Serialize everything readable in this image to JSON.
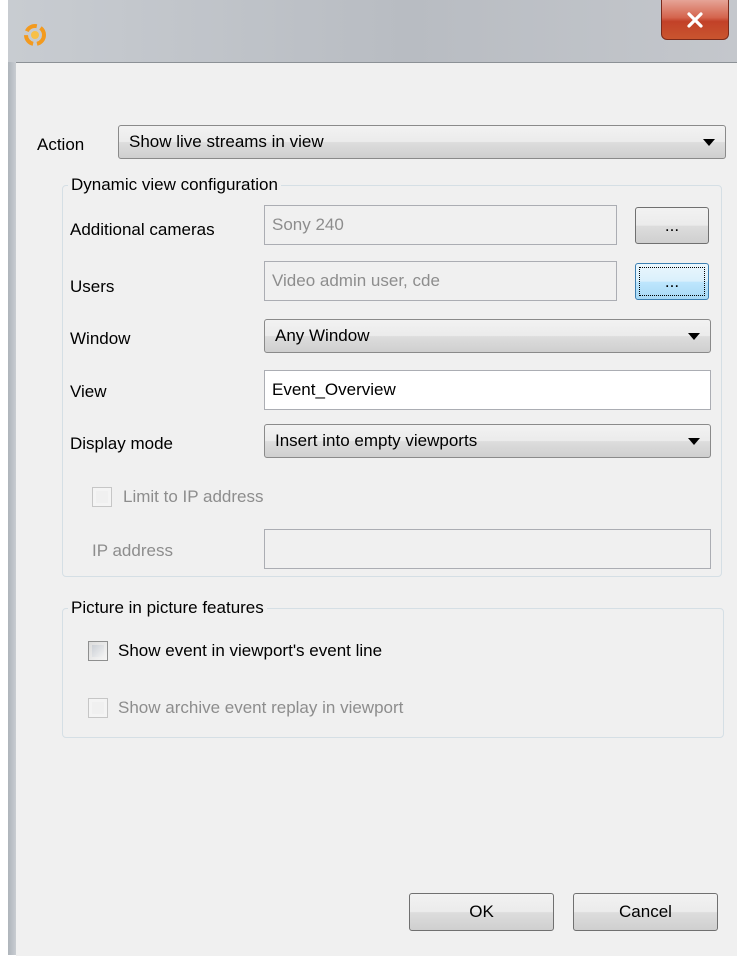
{
  "titlebar": {
    "icon": "app-logo-icon",
    "close_icon": "close-x-icon"
  },
  "action": {
    "label": "Action",
    "selected": "Show live streams in view"
  },
  "dynamic_group": {
    "title": "Dynamic view configuration",
    "additional_cameras": {
      "label": "Additional cameras",
      "value": "Sony 240",
      "browse": "..."
    },
    "users": {
      "label": "Users",
      "value": "Video admin user, cde",
      "browse": "..."
    },
    "window": {
      "label": "Window",
      "selected": "Any Window"
    },
    "view": {
      "label": "View",
      "value": "Event_Overview"
    },
    "display_mode": {
      "label": "Display mode",
      "selected": "Insert into empty viewports"
    },
    "limit_ip": {
      "label": "Limit to IP address",
      "checked": false,
      "enabled": false
    },
    "ip_address": {
      "label": "IP address",
      "value": ""
    }
  },
  "pip_group": {
    "title": "Picture in picture features",
    "show_event_line": {
      "label": "Show event in viewport's event line",
      "checked": false
    },
    "show_archive_replay": {
      "label": "Show archive event replay in viewport",
      "checked": false,
      "enabled": false
    }
  },
  "buttons": {
    "ok": "OK",
    "cancel": "Cancel"
  },
  "colors": {
    "close_red": "#c24128",
    "focus_blue": "#3c7fb1",
    "disabled_text": "#8d8d8d"
  }
}
